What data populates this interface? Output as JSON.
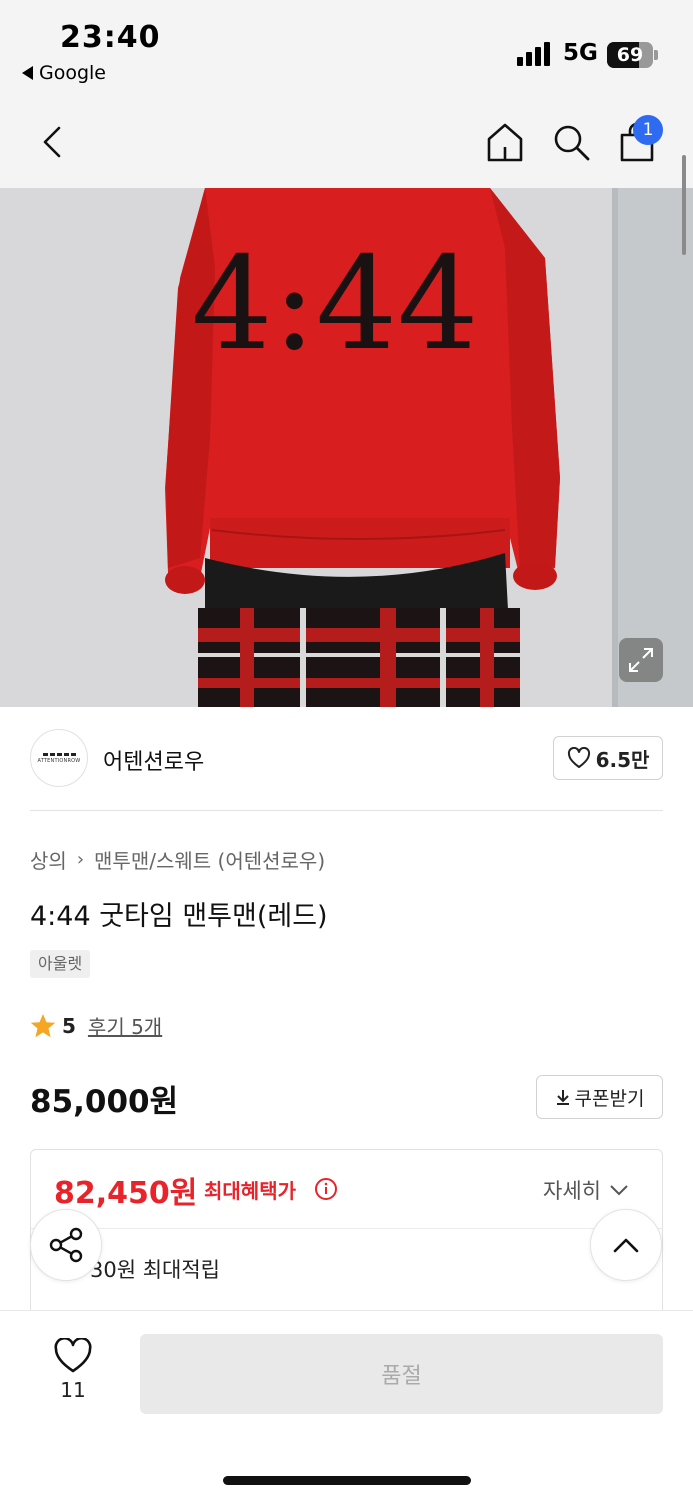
{
  "status_bar": {
    "time": "23:40",
    "back_app": "Google",
    "network": "5G",
    "battery": "69",
    "battery_level_percent": 69
  },
  "nav": {
    "back_icon": "chevron-left-icon",
    "home_icon": "home-icon",
    "search_icon": "search-icon",
    "cart_icon": "shopping-bag-icon",
    "cart_badge": "1"
  },
  "hero": {
    "print_text": "4:44",
    "expand_icon": "expand-icon"
  },
  "brand": {
    "logo_text": "ATTENTIONROW",
    "name": "어텐션로우",
    "like_count": "6.5만"
  },
  "product": {
    "breadcrumb": [
      "상의",
      "맨투맨/스웨트 (어텐션로우)"
    ],
    "title": "4:44 굿타임 맨투맨(레드)",
    "tag": "아울렛",
    "rating": "5",
    "reviews": "후기 5개",
    "price": "85,000원",
    "coupon_label": "쿠폰받기"
  },
  "benefit": {
    "max_price": "82,450원",
    "max_label": "최대혜택가",
    "detail_label": "자세히",
    "points": "30원 최대적립"
  },
  "bottom_bar": {
    "wish_count": "11",
    "soldout_label": "품절"
  },
  "colors": {
    "accent_red": "#e8232a",
    "badge_blue": "#2e6bf0",
    "star": "#f5a623"
  }
}
